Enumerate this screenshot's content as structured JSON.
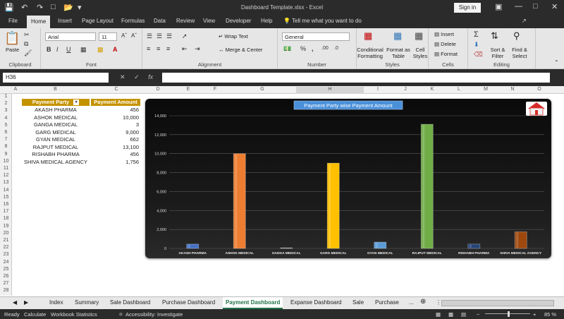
{
  "window": {
    "title": "Dashboard Template.xlsx  -  Excel",
    "sign_in": "Sign in"
  },
  "ribbon_tabs": [
    "File",
    "Home",
    "Insert",
    "Page Layout",
    "Formulas",
    "Data",
    "Review",
    "View",
    "Developer",
    "Help"
  ],
  "tell_me": "Tell me what you want to do",
  "ribbon": {
    "clipboard": {
      "paste": "Paste",
      "label": "Clipboard"
    },
    "font": {
      "name": "Arial",
      "size": "11",
      "label": "Font"
    },
    "alignment": {
      "wrap": "Wrap Text",
      "merge": "Merge & Center",
      "label": "Alignment"
    },
    "number": {
      "format": "General",
      "label": "Number"
    },
    "styles": {
      "conditional": "Conditional",
      "conditional2": "Formatting",
      "format_as": "Format as",
      "format_as2": "Table",
      "cell": "Cell",
      "cell2": "Styles",
      "label": "Styles"
    },
    "cells": {
      "insert": "Insert",
      "delete": "Delete",
      "format": "Format",
      "label": "Cells"
    },
    "editing": {
      "sort": "Sort &",
      "sort2": "Filter",
      "find": "Find &",
      "find2": "Select",
      "label": "Editing"
    }
  },
  "formula_bar": {
    "name_box": "H36",
    "fx": "fx",
    "value": ""
  },
  "columns": [
    "A",
    "B",
    "C",
    "D",
    "E",
    "F",
    "G",
    "H",
    "I",
    "J",
    "K",
    "L",
    "M",
    "N",
    "O"
  ],
  "rows": [
    "1",
    "2",
    "3",
    "4",
    "5",
    "6",
    "7",
    "8",
    "9",
    "10",
    "11",
    "12",
    "13",
    "14",
    "15",
    "16",
    "17",
    "18",
    "19",
    "20",
    "21",
    "22",
    "23",
    "24",
    "25",
    "26",
    "27",
    "28"
  ],
  "table": {
    "headers": [
      "Payment Party",
      "Payment Amount"
    ],
    "rows": [
      {
        "party": "AKASH PHARMA",
        "amount": "456"
      },
      {
        "party": "ASHOK MEDICAL",
        "amount": "10,000"
      },
      {
        "party": "GANGA MEDICAL",
        "amount": "3"
      },
      {
        "party": "GARG MEDICAL",
        "amount": "9,000"
      },
      {
        "party": "GYAN MEDICAL",
        "amount": "662"
      },
      {
        "party": "RAJPUT MEDICAL",
        "amount": "13,100"
      },
      {
        "party": "RISHABH PHARMA",
        "amount": "456"
      },
      {
        "party": "SHIVA MEDICAL AGENCY",
        "amount": "1,756"
      }
    ]
  },
  "chart_data": {
    "type": "bar",
    "title": "Payment Party wise Payment Amount",
    "categories": [
      "AKASH PHARMA",
      "ASHOK MEDICAL",
      "GANGA MEDICAL",
      "GARG MEDICAL",
      "GYAN MEDICAL",
      "RAJPUT MEDICAL",
      "RISHABH PHARMA",
      "SHIVA MEDICAL AGENCY"
    ],
    "values": [
      456,
      10000,
      3,
      9000,
      662,
      13100,
      456,
      1756
    ],
    "colors": [
      "#4472c4",
      "#ed7d31",
      "#a5a5a5",
      "#ffc000",
      "#5b9bd5",
      "#70ad47",
      "#264478",
      "#9e480e"
    ],
    "ylim": [
      0,
      14000
    ],
    "yticks": [
      "0",
      "2,000",
      "4,000",
      "6,000",
      "8,000",
      "10,000",
      "12,000",
      "14,000"
    ],
    "grid": true,
    "legend": "none",
    "icon": "home-icon"
  },
  "sheet_tabs": [
    "Index",
    "Summary",
    "Sale Dashboard",
    "Purchase Dashboard",
    "Payment Dashboard",
    "Expanse Dashboard",
    "Sale",
    "Purchase",
    "..."
  ],
  "active_sheet": "Payment Dashboard",
  "status": {
    "ready": "Ready",
    "calculate": "Calculate",
    "stats": "Workbook Statistics",
    "accessibility": "Accessibility: Investigate",
    "zoom": "85 %"
  }
}
